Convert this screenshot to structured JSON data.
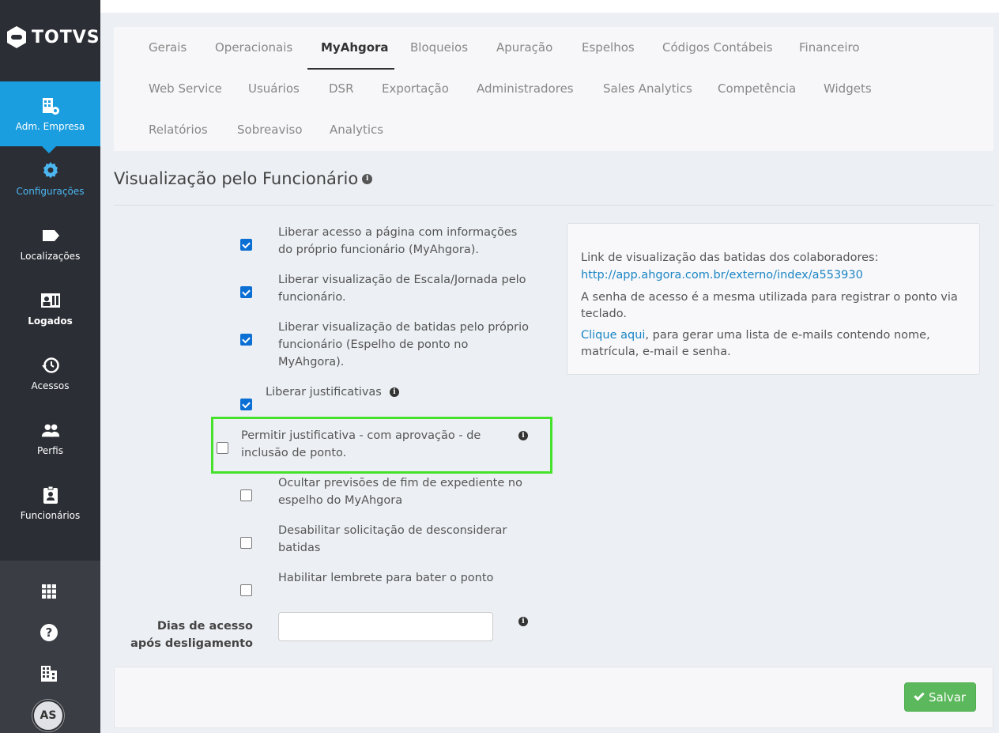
{
  "brand": {
    "logo_text": "TOTVS"
  },
  "sidebar": {
    "items": [
      {
        "label": "Adm. Empresa",
        "icon": "building-gear-icon"
      },
      {
        "label": "Configurações",
        "icon": "gear-icon"
      },
      {
        "label": "Localizações",
        "icon": "tag-icon"
      },
      {
        "label": "Logados",
        "icon": "id-card-icon"
      },
      {
        "label": "Acessos",
        "icon": "history-icon"
      },
      {
        "label": "Perfis",
        "icon": "users-icon"
      },
      {
        "label": "Funcionários",
        "icon": "badge-icon"
      }
    ],
    "bottom_icons": [
      "apps-grid-icon",
      "help-icon",
      "company-icon"
    ],
    "avatar_initials": "AS"
  },
  "tabs": {
    "row1": [
      "Gerais",
      "Operacionais",
      "MyAhgora",
      "Bloqueios",
      "Apuração",
      "Espelhos",
      "Códigos Contábeis",
      "Financeiro"
    ],
    "row2": [
      "Web Service",
      "Usuários",
      "DSR",
      "Exportação",
      "Administradores",
      "Sales Analytics",
      "Competência",
      "Widgets"
    ],
    "row3": [
      "Relatórios",
      "Sobreaviso",
      "Analytics"
    ],
    "active": "MyAhgora"
  },
  "section": {
    "title": "Visualização pelo Funcionário"
  },
  "options": [
    {
      "label": "Liberar acesso a página com informações do próprio funcionário (MyAhgora).",
      "checked": true
    },
    {
      "label": "Liberar visualização de Escala/Jornada pelo funcionário.",
      "checked": true
    },
    {
      "label": "Liberar visualização de batidas pelo próprio funcionário (Espelho de ponto no MyAhgora).",
      "checked": true
    },
    {
      "label": "Liberar justificativas",
      "checked": true
    },
    {
      "label": "Permitir justificativa - com aprovação - de inclusão de ponto.",
      "checked": false
    },
    {
      "label": "Ocultar previsões de fim de expediente no espelho do MyAhgora",
      "checked": false
    },
    {
      "label": "Desabilitar solicitação de desconsiderar batidas",
      "checked": false
    },
    {
      "label": "Habilitar lembrete para bater o ponto",
      "checked": false
    }
  ],
  "dias_field": {
    "label": "Dias de acesso após desligamento",
    "value": ""
  },
  "info_box": {
    "line1": "Link de visualização das batidas dos colaboradores:",
    "url": "http://app.ahgora.com.br/externo/index/a553930",
    "line2": "A senha de acesso é a mesma utilizada para registrar o ponto via teclado.",
    "link_text": "Clique aqui",
    "line3": ", para gerar uma lista de e-mails contendo nome, matrícula, e-mail e senha."
  },
  "footer": {
    "save_label": "Salvar"
  },
  "colors": {
    "accent": "#1a9ee0",
    "sidebar": "#2b2e35",
    "save": "#5cb85c",
    "highlight": "#46e22b",
    "checkbox": "#0c6fd4"
  }
}
